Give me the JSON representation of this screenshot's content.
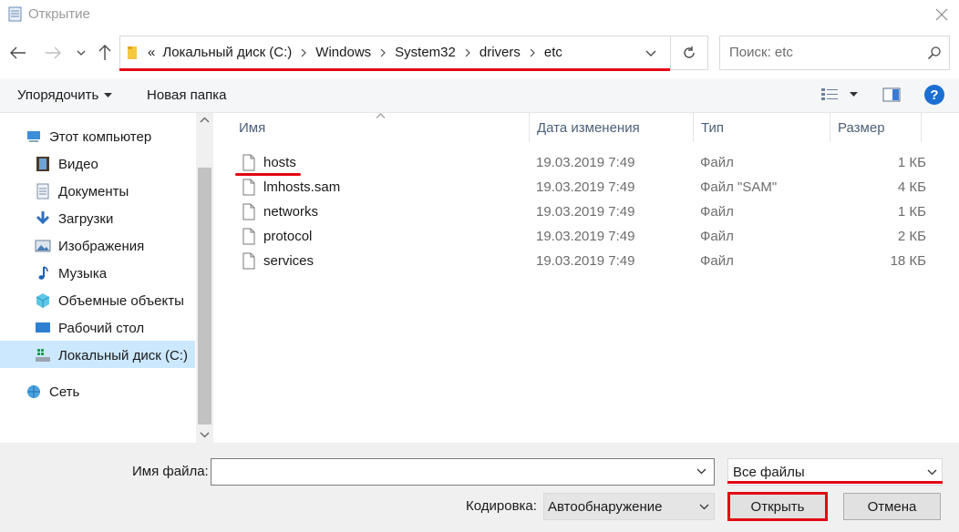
{
  "window": {
    "title": "Открытие"
  },
  "address": {
    "overflow": "«",
    "crumbs": [
      "Локальный диск (C:)",
      "Windows",
      "System32",
      "drivers",
      "etc"
    ]
  },
  "search": {
    "placeholder": "Поиск: etc"
  },
  "toolbar": {
    "organize": "Упорядочить",
    "new_folder": "Новая папка",
    "help": "?"
  },
  "sidebar": {
    "items": [
      {
        "label": "Этот компьютер",
        "icon": "computer-icon"
      },
      {
        "label": "Видео",
        "icon": "video-icon"
      },
      {
        "label": "Документы",
        "icon": "documents-icon"
      },
      {
        "label": "Загрузки",
        "icon": "downloads-icon"
      },
      {
        "label": "Изображения",
        "icon": "pictures-icon"
      },
      {
        "label": "Музыка",
        "icon": "music-icon"
      },
      {
        "label": "Объемные объекты",
        "icon": "3d-objects-icon"
      },
      {
        "label": "Рабочий стол",
        "icon": "desktop-icon"
      },
      {
        "label": "Локальный диск (C:)",
        "icon": "drive-icon",
        "selected": true
      },
      {
        "label": "Сеть",
        "icon": "network-icon"
      }
    ]
  },
  "columns": {
    "name": "Имя",
    "date": "Дата изменения",
    "type": "Тип",
    "size": "Размер"
  },
  "files": [
    {
      "name": "hosts",
      "date": "19.03.2019 7:49",
      "type": "Файл",
      "size": "1 КБ"
    },
    {
      "name": "lmhosts.sam",
      "date": "19.03.2019 7:49",
      "type": "Файл \"SAM\"",
      "size": "4 КБ"
    },
    {
      "name": "networks",
      "date": "19.03.2019 7:49",
      "type": "Файл",
      "size": "1 КБ"
    },
    {
      "name": "protocol",
      "date": "19.03.2019 7:49",
      "type": "Файл",
      "size": "2 КБ"
    },
    {
      "name": "services",
      "date": "19.03.2019 7:49",
      "type": "Файл",
      "size": "18 КБ"
    }
  ],
  "bottom": {
    "filename_label": "Имя файла:",
    "filename_value": "",
    "filter": "Все файлы",
    "encoding_label": "Кодировка:",
    "encoding_value": "Автообнаружение",
    "open": "Открыть",
    "cancel": "Отмена"
  },
  "colors": {
    "highlight": "#e30613",
    "selection": "#cce8ff",
    "help": "#1a6fd1"
  }
}
